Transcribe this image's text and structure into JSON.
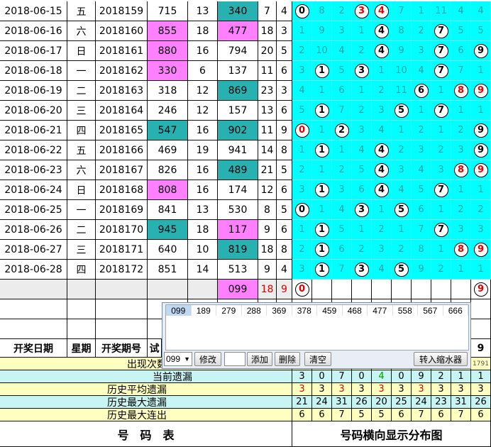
{
  "rows": [
    {
      "date": "2018-06-15",
      "wk": "五",
      "issue": "2018159",
      "num": "715",
      "s1": "13",
      "t": "340",
      "s2": "7",
      "s3": "4",
      "digits": [
        "0",
        "8",
        "2",
        "3",
        "4",
        "7",
        "1",
        "11",
        "4",
        "4"
      ],
      "balls": [
        0,
        3,
        4
      ],
      "red": [
        3,
        4
      ]
    },
    {
      "date": "2018-06-16",
      "wk": "六",
      "issue": "2018160",
      "num": "855",
      "s1": "18",
      "t": "477",
      "s2": "18",
      "s3": "3",
      "digits": [
        "1",
        "9",
        "3",
        "1",
        "4",
        "8",
        "2",
        "7",
        "5",
        "5"
      ],
      "balls": [
        4,
        7
      ],
      "red": []
    },
    {
      "date": "2018-06-17",
      "wk": "日",
      "issue": "2018161",
      "num": "880",
      "s1": "16",
      "t": "794",
      "s2": "20",
      "s3": "5",
      "digits": [
        "2",
        "10",
        "4",
        "2",
        "4",
        "9",
        "3",
        "7",
        "6",
        "9"
      ],
      "balls": [
        4,
        7,
        9
      ],
      "red": []
    },
    {
      "date": "2018-06-18",
      "wk": "一",
      "issue": "2018162",
      "num": "330",
      "s1": "6",
      "t": "137",
      "s2": "11",
      "s3": "6",
      "digits": [
        "3",
        "1",
        "5",
        "3",
        "1",
        "10",
        "4",
        "7",
        "7",
        "1"
      ],
      "balls": [
        1,
        3,
        7
      ],
      "red": []
    },
    {
      "date": "2018-06-19",
      "wk": "二",
      "issue": "2018163",
      "num": "318",
      "s1": "12",
      "t": "869",
      "s2": "23",
      "s3": "3",
      "digits": [
        "4",
        "1",
        "6",
        "1",
        "2",
        "11",
        "6",
        "1",
        "8",
        "9"
      ],
      "balls": [
        6,
        8,
        9
      ],
      "red": [
        8,
        9
      ]
    },
    {
      "date": "2018-06-20",
      "wk": "三",
      "issue": "2018164",
      "num": "246",
      "s1": "12",
      "t": "157",
      "s2": "13",
      "s3": "6",
      "digits": [
        "5",
        "1",
        "7",
        "2",
        "3",
        "5",
        "1",
        "7",
        "1",
        "1"
      ],
      "balls": [
        1,
        5,
        7
      ],
      "red": []
    },
    {
      "date": "2018-06-21",
      "wk": "四",
      "issue": "2018165",
      "num": "547",
      "s1": "16",
      "t": "902",
      "s2": "11",
      "s3": "9",
      "digits": [
        "0",
        "1",
        "2",
        "3",
        "4",
        "1",
        "2",
        "1",
        "2",
        "9"
      ],
      "balls": [
        0,
        2,
        9
      ],
      "red": [
        0
      ]
    },
    {
      "date": "2018-06-22",
      "wk": "五",
      "issue": "2018166",
      "num": "469",
      "s1": "19",
      "t": "941",
      "s2": "14",
      "s3": "8",
      "digits": [
        "1",
        "1",
        "1",
        "4",
        "4",
        "2",
        "3",
        "2",
        "3",
        "9"
      ],
      "balls": [
        1,
        4,
        9
      ],
      "red": []
    },
    {
      "date": "2018-06-23",
      "wk": "六",
      "issue": "2018167",
      "num": "826",
      "s1": "16",
      "t": "489",
      "s2": "21",
      "s3": "5",
      "digits": [
        "2",
        "1",
        "2",
        "5",
        "4",
        "3",
        "4",
        "3",
        "8",
        "9"
      ],
      "balls": [
        4,
        8,
        9
      ],
      "red": [
        8,
        9
      ]
    },
    {
      "date": "2018-06-24",
      "wk": "日",
      "issue": "2018168",
      "num": "808",
      "s1": "16",
      "t": "174",
      "s2": "12",
      "s3": "6",
      "digits": [
        "3",
        "1",
        "3",
        "6",
        "4",
        "4",
        "5",
        "7",
        "1",
        "1"
      ],
      "balls": [
        1,
        4,
        7
      ],
      "red": []
    },
    {
      "date": "2018-06-25",
      "wk": "一",
      "issue": "2018169",
      "num": "841",
      "s1": "13",
      "t": "530",
      "s2": "8",
      "s3": "5",
      "digits": [
        "0",
        "1",
        "4",
        "3",
        "1",
        "5",
        "6",
        "1",
        "2",
        "2"
      ],
      "balls": [
        0,
        3,
        5
      ],
      "red": []
    },
    {
      "date": "2018-06-26",
      "wk": "二",
      "issue": "2018170",
      "num": "945",
      "s1": "18",
      "t": "117",
      "s2": "9",
      "s3": "6",
      "digits": [
        "1",
        "1",
        "5",
        "1",
        "2",
        "1",
        "7",
        "7",
        "3",
        "3"
      ],
      "balls": [
        1,
        7
      ],
      "red": []
    },
    {
      "date": "2018-06-27",
      "wk": "三",
      "issue": "2018171",
      "num": "640",
      "s1": "10",
      "t": "819",
      "s2": "18",
      "s3": "8",
      "digits": [
        "2",
        "1",
        "6",
        "2",
        "3",
        "2",
        "8",
        "1",
        "8",
        "9"
      ],
      "balls": [
        1,
        8,
        9
      ],
      "red": [
        8,
        9
      ]
    },
    {
      "date": "2018-06-28",
      "wk": "四",
      "issue": "2018172",
      "num": "851",
      "s1": "14",
      "t": "513",
      "s2": "9",
      "s3": "4",
      "digits": [
        "3",
        "1",
        "7",
        "3",
        "4",
        "5",
        "9",
        "2",
        "1",
        "1"
      ],
      "balls": [
        1,
        3,
        5
      ],
      "red": []
    }
  ],
  "pred": {
    "t": "099",
    "s2": "18",
    "s3": "9",
    "ball0": "0",
    "ball9": "9"
  },
  "headers": {
    "date": "开奖日期",
    "week": "星期",
    "issue": "开奖期号",
    "trial": "试",
    "last_digit": "9"
  },
  "dialog": {
    "combos": [
      "099",
      "189",
      "279",
      "288",
      "369",
      "378",
      "459",
      "468",
      "477",
      "558",
      "567",
      "666"
    ],
    "select_value": "099",
    "modify": "修改",
    "add": "添加",
    "delete": "删除",
    "clear": "清空",
    "to_shrink": "转入缩水器"
  },
  "stats": {
    "appear_label": "出现次数",
    "appear_value": "1791",
    "current_label": "当前遗漏",
    "current": [
      "3",
      "0",
      "7",
      "0",
      "4",
      "0",
      "9",
      "2",
      "1",
      "1"
    ],
    "avg_label": "历史平均遗漏",
    "avg": [
      "3",
      "3",
      "3",
      "3",
      "3",
      "3",
      "3",
      "3",
      "3",
      "3"
    ],
    "avg_red": [
      0,
      2,
      4,
      6
    ],
    "max_label": "历史最大遗漏",
    "max": [
      "21",
      "24",
      "31",
      "26",
      "20",
      "25",
      "24",
      "23",
      "31",
      "26"
    ],
    "maxrun_label": "历史最大连出",
    "maxrun": [
      "6",
      "6",
      "7",
      "5",
      "5",
      "6",
      "7",
      "6",
      "7",
      "6"
    ]
  },
  "footer": {
    "left": "号　码　表",
    "right": "号码横向显示分布图"
  },
  "colors": {
    "cyan": "#00ffff",
    "teal": "#27b1b1",
    "pink": "#ff80ff",
    "red": "#e00000",
    "yellow_band": "#ffffc0"
  }
}
